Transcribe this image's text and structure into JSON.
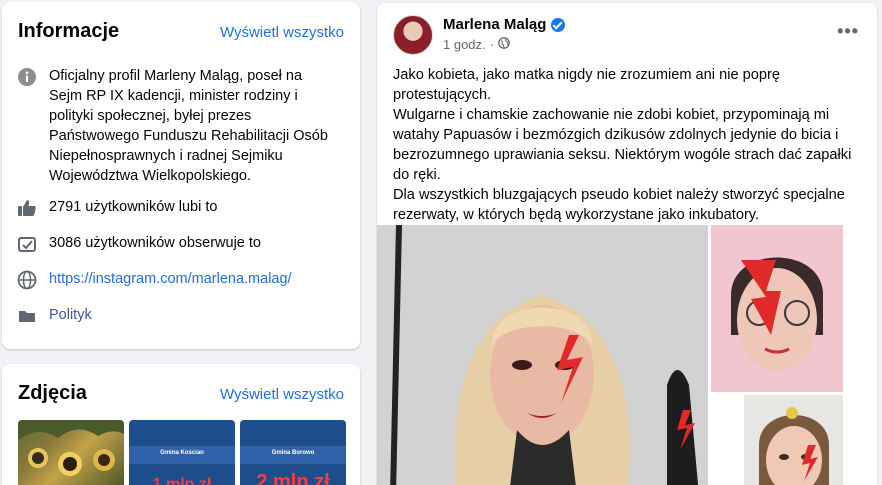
{
  "info": {
    "title": "Informacje",
    "see_all": "Wyświetl wszystko",
    "description": "Oficjalny profil Marleny Maląg, poseł na Sejm RP IX kadencji, minister rodziny i polityki społecznej, byłej prezes Państwowego Funduszu Rehabilitacji Osób Niepełnosprawnych i radnej Sejmiku Województwa Wielkopolskiego.",
    "likes": "2791 użytkowników lubi to",
    "followers": "3086 użytkowników obserwuje to",
    "website": "https://instagram.com/marlena.malag/",
    "category": "Polityk",
    "icons": [
      "info-icon",
      "like-icon",
      "follow-icon",
      "globe-icon",
      "category-icon"
    ]
  },
  "photos": {
    "title": "Zdjęcia",
    "see_all": "Wyświetl wszystko",
    "thumbs": [
      {
        "band": "",
        "amount": ""
      },
      {
        "band": "Gmina Kościan",
        "amount": "1 mln zł"
      },
      {
        "band": "Gmina Borowo",
        "amount": "2 mln zł"
      }
    ]
  },
  "post": {
    "author": "Marlena Maląg",
    "time": "1 godz.",
    "separator": "·",
    "more": "•••",
    "text": [
      "Jako kobieta, jako matka nigdy nie zrozumiem ani nie poprę protestujących.",
      "Wulgarne i chamskie zachowanie nie zdobi kobiet, przypominają mi watahy Papuasów i bezmózgich dzikusów zdolnych jedynie do bicia i bezrozumnego uprawiania seksu. Niektórym wogóle strach dać zapałki do ręki.",
      "Dla wszystkich bluzgających pseudo kobiet należy stworzyć specjalne rezerwaty, w których będą wykorzystane jako inkubatory."
    ]
  },
  "colors": {
    "link": "#216fdb",
    "verified": "#1877f2",
    "background": "#f0f2f5",
    "secondary_text": "#65676b",
    "bolt_red": "#e02a2a"
  }
}
